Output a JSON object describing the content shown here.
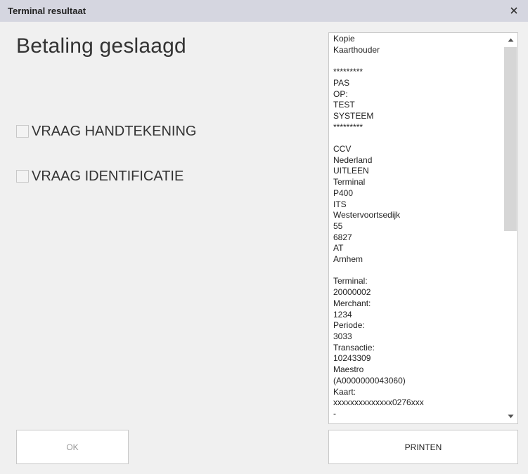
{
  "window": {
    "title": "Terminal resultaat",
    "close_icon": "close-icon"
  },
  "main": {
    "heading": "Betaling geslaagd",
    "checkboxes": [
      {
        "label": "VRAAG HANDTEKENING",
        "checked": false
      },
      {
        "label": "VRAAG IDENTIFICATIE",
        "checked": false
      }
    ]
  },
  "receipt": {
    "lines": [
      "Kopie",
      "Kaarthouder",
      "",
      "*********",
      "PAS",
      "OP:",
      "TEST",
      "SYSTEEM",
      "*********",
      "",
      "CCV",
      "Nederland",
      "UITLEEN",
      "Terminal",
      "P400",
      "ITS",
      "Westervoortsedijk",
      "55",
      "6827",
      "AT",
      "Arnhem",
      "",
      "Terminal:",
      "20000002",
      "Merchant:",
      "1234",
      "Periode:",
      "3033",
      "Transactie:",
      "10243309",
      "Maestro",
      "(A0000000043060)",
      "Kaart:",
      "xxxxxxxxxxxxxx0276xxx",
      "-"
    ]
  },
  "buttons": {
    "ok_label": "OK",
    "print_label": "PRINTEN"
  },
  "colors": {
    "titlebar": "#d5d6e0",
    "background": "#f0f0f0",
    "disabled_text": "#9a9a9a"
  }
}
